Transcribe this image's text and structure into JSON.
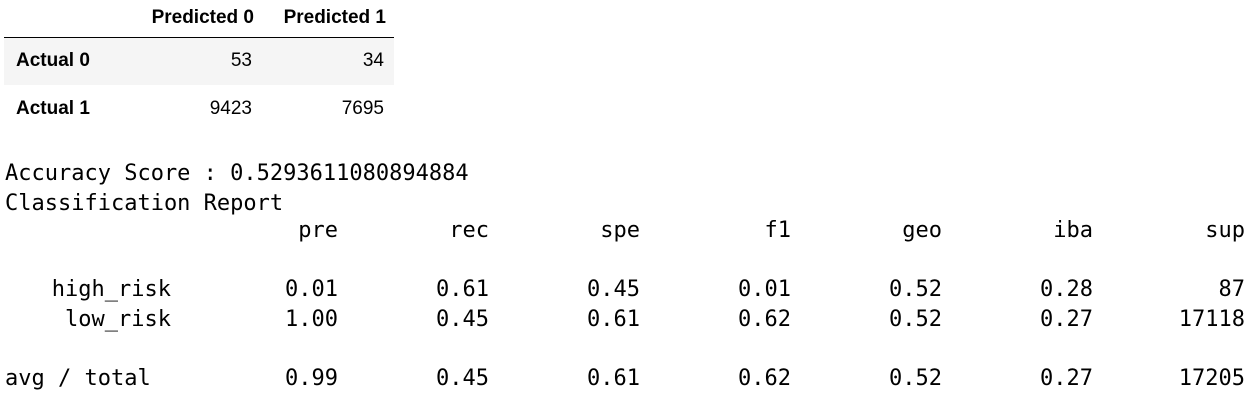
{
  "confusion_matrix": {
    "columns": [
      "Predicted 0",
      "Predicted 1"
    ],
    "rows": [
      {
        "label": "Actual 0",
        "values": [
          "53",
          "34"
        ]
      },
      {
        "label": "Actual 1",
        "values": [
          "9423",
          "7695"
        ]
      }
    ]
  },
  "accuracy_line": "Accuracy Score : 0.5293611080894884",
  "report_title": "Classification Report",
  "report": {
    "headers": [
      "pre",
      "rec",
      "spe",
      "f1",
      "geo",
      "iba",
      "sup"
    ],
    "rows": [
      {
        "label": "high_risk",
        "values": [
          "0.01",
          "0.61",
          "0.45",
          "0.01",
          "0.52",
          "0.28",
          "87"
        ]
      },
      {
        "label": "low_risk",
        "values": [
          "1.00",
          "0.45",
          "0.61",
          "0.62",
          "0.52",
          "0.27",
          "17118"
        ]
      }
    ],
    "total": {
      "label": "avg / total",
      "values": [
        "0.99",
        "0.45",
        "0.61",
        "0.62",
        "0.52",
        "0.27",
        "17205"
      ]
    }
  }
}
